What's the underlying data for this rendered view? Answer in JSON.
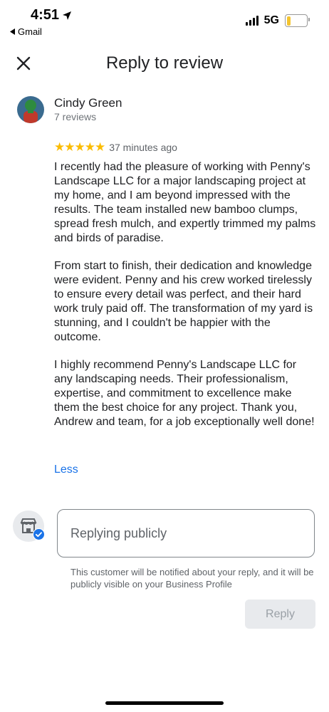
{
  "status_bar": {
    "time": "4:51",
    "network": "5G",
    "back_app": "Gmail",
    "battery_color": "#f4c430"
  },
  "header": {
    "title": "Reply to review"
  },
  "reviewer": {
    "name": "Cindy Green",
    "review_count": "7 reviews",
    "rating": 5,
    "stars": "★★★★★",
    "time_ago": "37 minutes ago"
  },
  "review": {
    "paragraphs": [
      "I recently had the pleasure of working with Penny's Landscape LLC for a major landscaping project at my home, and I am beyond impressed with the results. The team installed new bamboo clumps, spread fresh mulch, and expertly trimmed my palms and birds of paradise.",
      "From start to finish, their dedication and knowledge were evident. Penny and his crew worked tirelessly to ensure every detail was perfect, and their hard work truly paid off. The transformation of my yard is stunning, and I couldn't be happier with the outcome.",
      "I highly recommend Penny's Landscape LLC for any landscaping needs. Their professionalism, expertise, and commitment to excellence make them the best choice for any project. Thank you, Andrew and team, for a job exceptionally well done!"
    ],
    "less_label": "Less"
  },
  "reply": {
    "placeholder": "Replying publicly",
    "value": "",
    "notice": "This customer will be notified about your reply, and it will be publicly visible on your Business Profile",
    "button_label": "Reply"
  },
  "colors": {
    "accent": "#1a73e8",
    "star": "#fbbc04",
    "verified": "#1a73e8"
  },
  "icons": [
    "location-arrow-icon",
    "back-arrow-icon",
    "signal-icon",
    "battery-icon",
    "close-icon",
    "avatar",
    "storefront-icon",
    "verified-badge-icon"
  ]
}
